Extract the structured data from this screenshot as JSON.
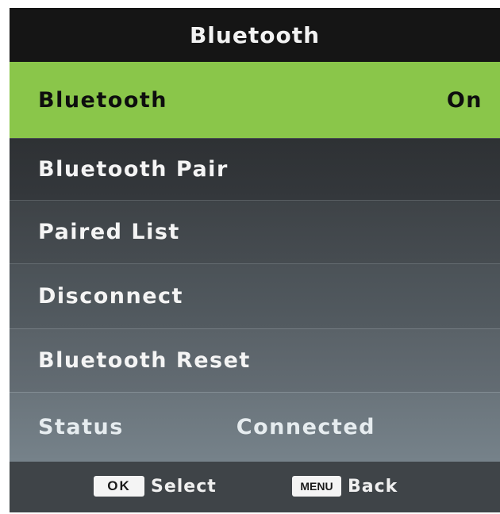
{
  "header": {
    "title": "Bluetooth"
  },
  "menu": {
    "items": [
      {
        "label": "Bluetooth",
        "value": "On"
      },
      {
        "label": "Bluetooth Pair"
      },
      {
        "label": "Paired List"
      },
      {
        "label": "Disconnect"
      },
      {
        "label": "Bluetooth Reset"
      }
    ],
    "status": {
      "label": "Status",
      "value": "Connected"
    }
  },
  "footer": {
    "ok_key": "OK",
    "ok_action": "Select",
    "menu_key": "MENU",
    "menu_action": "Back"
  },
  "colors": {
    "highlight": "#8ac64a",
    "header_bg": "#151515",
    "footer_bg": "#3f4448"
  }
}
